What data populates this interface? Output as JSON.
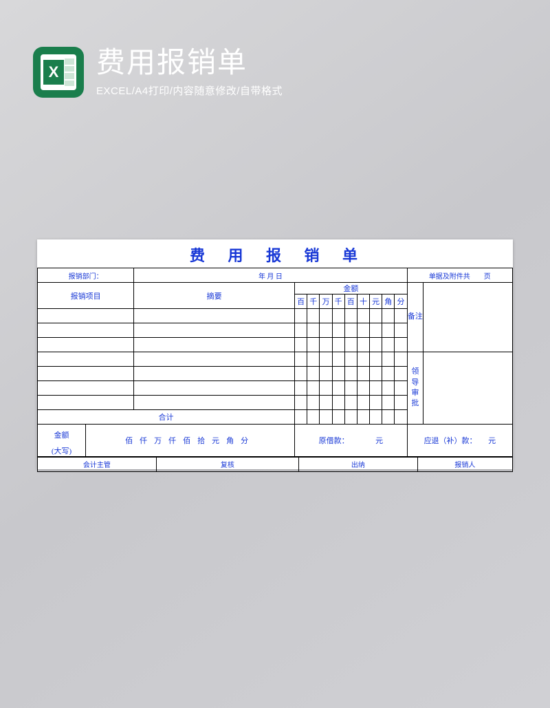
{
  "header": {
    "title": "费用报销单",
    "subtitle": "EXCEL/A4打印/内容随意修改/自带格式"
  },
  "form": {
    "title": "费 用 报 销 单",
    "dept_label": "报销部门：",
    "date_label": "年 月 日",
    "attachment_label": "单据及附件共　　页",
    "col_item": "报销项目",
    "col_summary": "摘要",
    "col_amount": "金额",
    "digits": [
      "百",
      "千",
      "万",
      "千",
      "百",
      "十",
      "元",
      "角",
      "分"
    ],
    "side_remark": "备注",
    "side_approval": "领导审批",
    "total_label": "合计",
    "amount_big_label1": "金额",
    "amount_big_label2": "(大写)",
    "big_units": [
      "佰",
      "仟",
      "万",
      "仟",
      "佰",
      "拾",
      "元",
      "角",
      "分"
    ],
    "loan_label": "原借款：",
    "loan_unit": "元",
    "refund_label": "应退（补）款：",
    "refund_unit": "元",
    "sig_accountant": "会计主管",
    "sig_review": "复核",
    "sig_cashier": "出纳",
    "sig_claimant": "报销人"
  }
}
